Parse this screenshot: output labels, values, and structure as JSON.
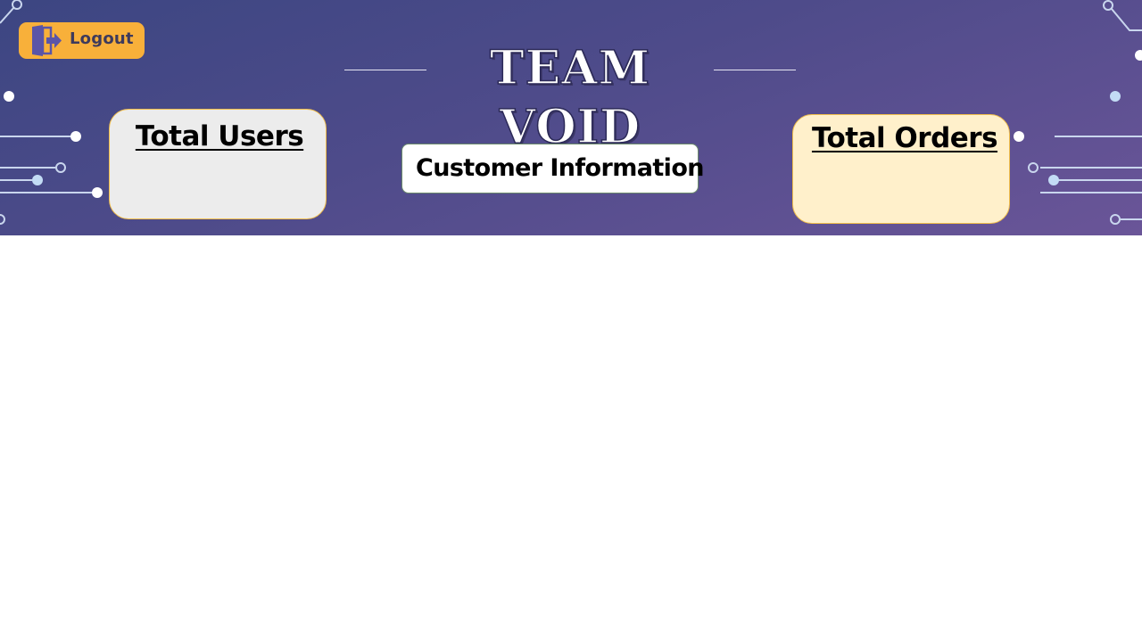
{
  "header": {
    "title": "TEAM VOID",
    "logout_label": "Logout"
  },
  "stats": {
    "users_title": "Total Users",
    "orders_title": "Total Orders"
  },
  "actions": {
    "customer_info_label": "Customer Information"
  },
  "colors": {
    "banner_gradient_start": "#3c4682",
    "banner_gradient_end": "#6a5598",
    "logout_bg": "#f8b03a",
    "users_card_bg": "#ececec",
    "orders_card_bg": "#fff0cb",
    "card_border": "#f0bd4a"
  },
  "icons": {
    "logout": "logout-door-arrow-icon",
    "decoration": "circuit-lines-icon"
  }
}
